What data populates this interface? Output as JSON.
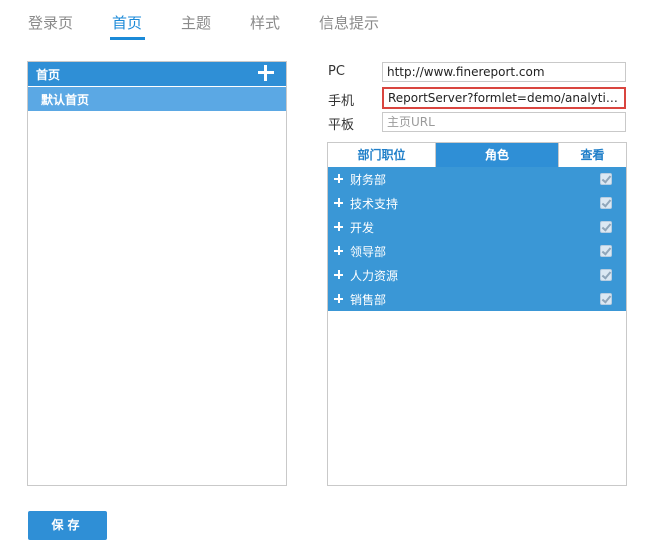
{
  "tabs": [
    {
      "label": "登录页",
      "active": false
    },
    {
      "label": "首页",
      "active": true
    },
    {
      "label": "主题",
      "active": false
    },
    {
      "label": "样式",
      "active": false
    },
    {
      "label": "信息提示",
      "active": false
    }
  ],
  "homepage_list": {
    "header_label": "首页",
    "add_icon": "plus-icon",
    "items": [
      {
        "label": "默认首页",
        "selected": true
      }
    ]
  },
  "form": {
    "pc": {
      "label": "PC",
      "value": "http://www.finereport.com"
    },
    "mobile": {
      "label": "手机",
      "value": "ReportServer?formlet=demo/analytics/ope..."
    },
    "tablet": {
      "label": "平板",
      "placeholder": "主页URL"
    }
  },
  "permissions": {
    "tabs": [
      {
        "label": "部门职位",
        "active": false
      },
      {
        "label": "角色",
        "active": true
      },
      {
        "label": "查看",
        "active": false
      }
    ],
    "rows": [
      {
        "name": "财务部",
        "checked": true
      },
      {
        "name": "技术支持",
        "checked": true
      },
      {
        "name": "开发",
        "checked": true
      },
      {
        "name": "领导部",
        "checked": true
      },
      {
        "name": "人力资源",
        "checked": true
      },
      {
        "name": "销售部",
        "checked": true
      }
    ]
  },
  "save_label": "保存",
  "colors": {
    "accent": "#2f8fd6",
    "highlight_border": "#d9453f",
    "tab_active": "#1b8ad8"
  }
}
